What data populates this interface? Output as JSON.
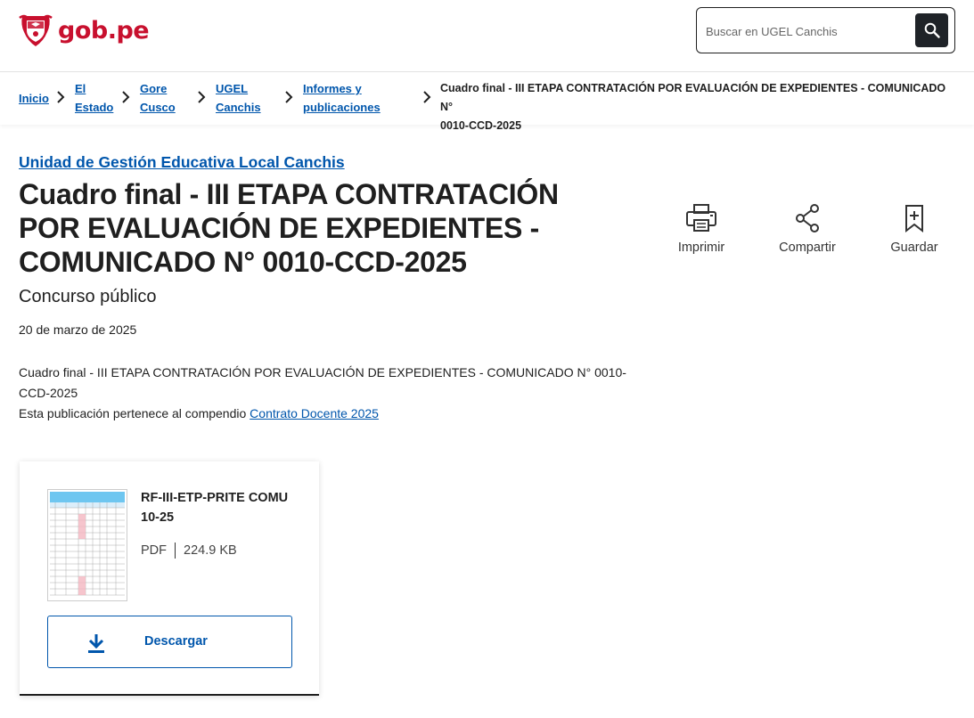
{
  "header": {
    "logo_text": "gob.pe",
    "search_placeholder": "Buscar en UGEL Canchis"
  },
  "breadcrumb": {
    "items": [
      {
        "label_lines": [
          "Inicio"
        ]
      },
      {
        "label_lines": [
          "El",
          "Estado"
        ]
      },
      {
        "label_lines": [
          "Gore",
          "Cusco"
        ]
      },
      {
        "label_lines": [
          "UGEL",
          "Canchis"
        ]
      },
      {
        "label_lines": [
          "Informes y",
          "publicaciones"
        ]
      }
    ],
    "current_lines": [
      "Cuadro final - III ETAPA CONTRATACIÓN POR EVALUACIÓN DE EXPEDIENTES - COMUNICADO N°",
      "0010-CCD-2025"
    ]
  },
  "main": {
    "agency_link": "Unidad de Gestión Educativa Local Canchis",
    "title_lines": [
      "Cuadro final - III ETAPA CONTRATACIÓN",
      "POR EVALUACIÓN DE EXPEDIENTES -",
      "COMUNICADO N° 0010-CCD-2025"
    ],
    "subtitle": "Concurso público",
    "date": "20 de marzo de 2025",
    "description_lines": [
      "Cuadro final - III ETAPA CONTRATACIÓN POR EVALUACIÓN DE EXPEDIENTES - COMUNICADO N° 0010-",
      "CCD-2025"
    ],
    "compendium_prefix": "Esta publicación pertenece al compendio ",
    "compendium_link": "Contrato Docente 2025"
  },
  "actions": {
    "print_label": "Imprimir",
    "share_label": "Compartir",
    "save_label": "Guardar"
  },
  "document": {
    "name_lines": [
      "RF-III-ETP-PRITE COMU",
      "10-25"
    ],
    "format": "PDF",
    "size": "224.9 KB",
    "download_label": "Descargar"
  },
  "colors": {
    "brand_red": "#c8102e",
    "link_blue": "#0056ac",
    "search_button": "#1f2328"
  },
  "icons": [
    "peru-coat-of-arms-icon",
    "search-icon",
    "chevron-right-icon",
    "print-icon",
    "share-icon",
    "bookmark-icon",
    "download-icon"
  ]
}
